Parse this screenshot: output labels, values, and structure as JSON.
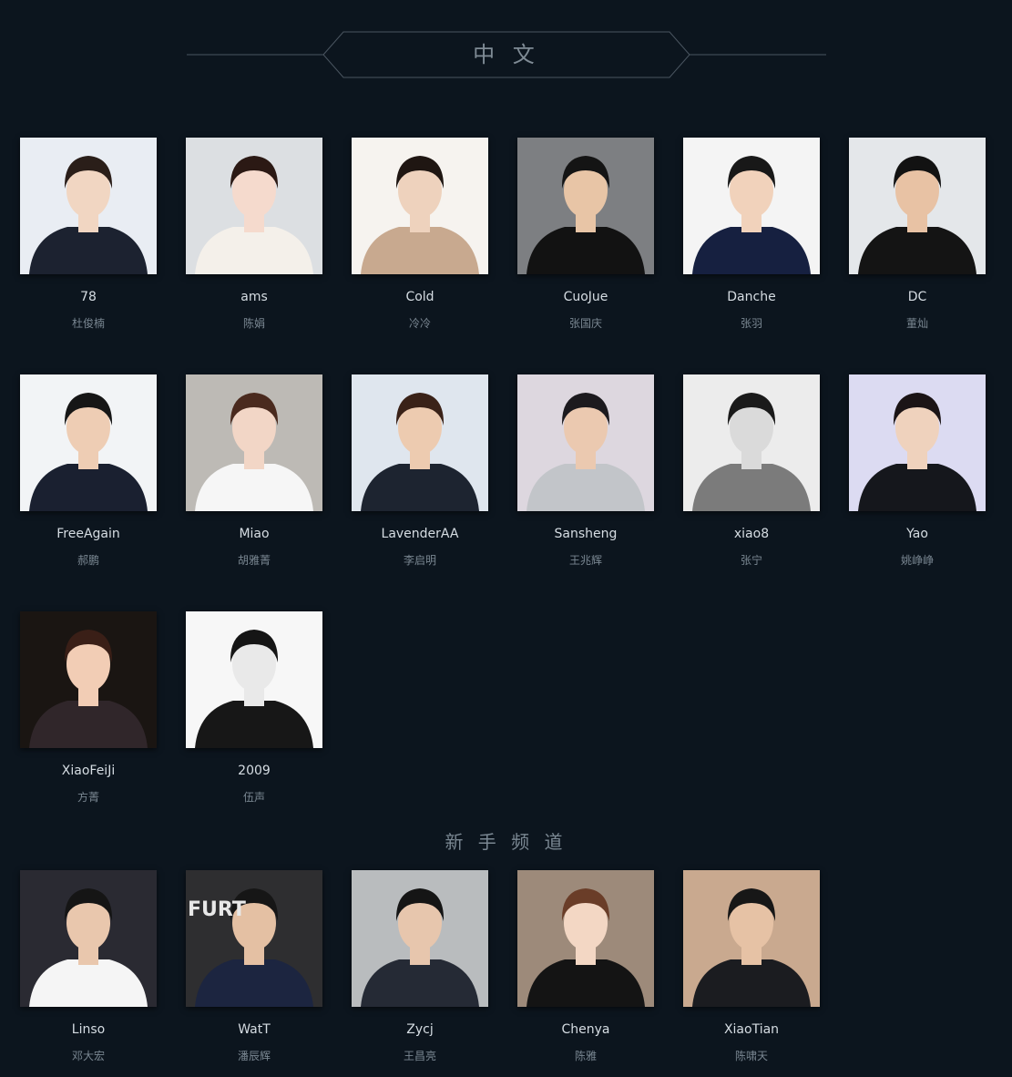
{
  "section": {
    "title": "中 文",
    "sub_title": "新 手 频 道"
  },
  "colors": {
    "background": "#0c151e",
    "nick": "#d6dde3",
    "realname": "#7a8792",
    "header_line": "#4a5560"
  },
  "players": [
    {
      "nick": "78",
      "name": "杜俊楠",
      "bg": "#e9edf3",
      "skin": "#f1d6c2",
      "hair": "#2a1e19",
      "cloth": "#1c2230"
    },
    {
      "nick": "ams",
      "name": "陈娟",
      "bg": "#dcdfe2",
      "skin": "#f5dacd",
      "hair": "#2b1914",
      "cloth": "#f4f0ea"
    },
    {
      "nick": "Cold",
      "name": "冷冷",
      "bg": "#f6f3ef",
      "skin": "#eed2bd",
      "hair": "#1f1612",
      "cloth": "#c8a98f"
    },
    {
      "nick": "CuoJue",
      "name": "张国庆",
      "bg": "#7d7f82",
      "skin": "#e8c5a6",
      "hair": "#141414",
      "cloth": "#121212"
    },
    {
      "nick": "Danche",
      "name": "张羽",
      "bg": "#f4f4f4",
      "skin": "#f1d2bb",
      "hair": "#181818",
      "cloth": "#162040"
    },
    {
      "nick": "DC",
      "name": "董灿",
      "bg": "#e4e7ea",
      "skin": "#e8c2a4",
      "hair": "#121212",
      "cloth": "#141414"
    },
    {
      "nick": "FreeAgain",
      "name": "郝鹏",
      "bg": "#f2f4f6",
      "skin": "#eecdb4",
      "hair": "#161616",
      "cloth": "#1a2030"
    },
    {
      "nick": "Miao",
      "name": "胡雅菁",
      "bg": "#bdbab5",
      "skin": "#f2d6c6",
      "hair": "#4a2a1e",
      "cloth": "#f6f6f6"
    },
    {
      "nick": "LavenderAA",
      "name": "李启明",
      "bg": "#dfe6ee",
      "skin": "#edcbb0",
      "hair": "#3a2218",
      "cloth": "#1d2430"
    },
    {
      "nick": "Sansheng",
      "name": "王兆辉",
      "bg": "#ddd7df",
      "skin": "#ebc9b0",
      "hair": "#1c1a1e",
      "cloth": "#c2c5c9"
    },
    {
      "nick": "xiao8",
      "name": "张宁",
      "bg": "#ececec",
      "skin": "#dadada",
      "hair": "#1a1a1a",
      "cloth": "#7b7b7b"
    },
    {
      "nick": "Yao",
      "name": "姚峥峥",
      "bg": "#dcdbf2",
      "skin": "#efd2bd",
      "hair": "#1b1416",
      "cloth": "#15171c"
    },
    {
      "nick": "XiaoFeiJi",
      "name": "方菁",
      "bg": "#1a1512",
      "skin": "#f2cdb5",
      "hair": "#3a1f17",
      "cloth": "#30262a"
    },
    {
      "nick": "2009",
      "name": "伍声",
      "bg": "#f7f7f7",
      "skin": "#e9e9e9",
      "hair": "#151515",
      "cloth": "#171717"
    }
  ],
  "newbie_players": [
    {
      "nick": "Linso",
      "name": "邓大宏",
      "bg": "#2a2a32",
      "skin": "#e9c7ad",
      "hair": "#151515",
      "cloth": "#f5f5f5"
    },
    {
      "nick": "WatT",
      "name": "潘辰辉",
      "bg": "#2e2e30",
      "skin": "#e4c0a3",
      "hair": "#161616",
      "cloth": "#1c2540",
      "overlay": "FURT"
    },
    {
      "nick": "Zycj",
      "name": "王昌亮",
      "bg": "#b9bcbe",
      "skin": "#e7c6ad",
      "hair": "#151515",
      "cloth": "#252a35"
    },
    {
      "nick": "Chenya",
      "name": "陈雅",
      "bg": "#9d8a7a",
      "skin": "#f3d7c4",
      "hair": "#6a3d28",
      "cloth": "#141414"
    },
    {
      "nick": "XiaoTian",
      "name": "陈啸天",
      "bg": "#c9a98f",
      "skin": "#e6c2a5",
      "hair": "#171717",
      "cloth": "#1b1c20"
    }
  ]
}
